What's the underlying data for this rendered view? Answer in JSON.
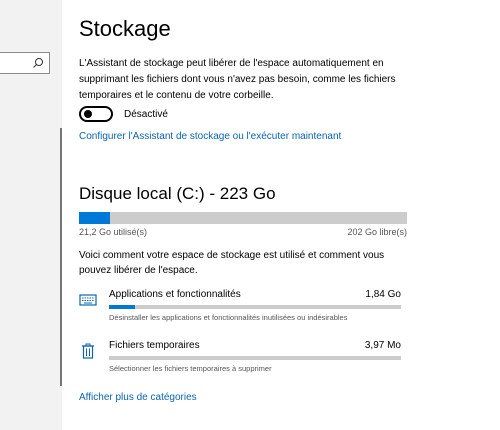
{
  "page": {
    "title": "Stockage",
    "description": "L'Assistant de stockage peut libérer de l'espace automatiquement en supprimant les fichiers dont vous n'avez pas besoin, comme les fichiers temporaires et le contenu de votre corbeille.",
    "toggle_label": "Désactivé",
    "toggle_state": "off",
    "configure_link": "Configurer l'Assistant de stockage ou l'exécuter maintenant"
  },
  "disk": {
    "title": "Disque local (C:) - 223 Go",
    "used_label": "21,2 Go utilisé(s)",
    "free_label": "202 Go libre(s)",
    "used_fraction": 0.095
  },
  "info_text": "Voici comment votre espace de stockage est utilisé et comment vous pouvez libérer de l'espace.",
  "categories": [
    {
      "name": "Applications et fonctionnalités",
      "size": "1,84 Go",
      "subtitle": "Désinstaller les applications et fonctionnalités inutilisées ou indésirables",
      "fill_fraction": 0.09,
      "icon": "keyboard-icon"
    },
    {
      "name": "Fichiers temporaires",
      "size": "3,97 Mo",
      "subtitle": "Sélectionner les fichiers temporaires à supprimer",
      "fill_fraction": 0.0,
      "icon": "trash-icon"
    }
  ],
  "more_link": "Afficher plus de catégories",
  "colors": {
    "accent": "#0078d7",
    "link": "#0a63b1",
    "bar_track": "#cccccc"
  }
}
